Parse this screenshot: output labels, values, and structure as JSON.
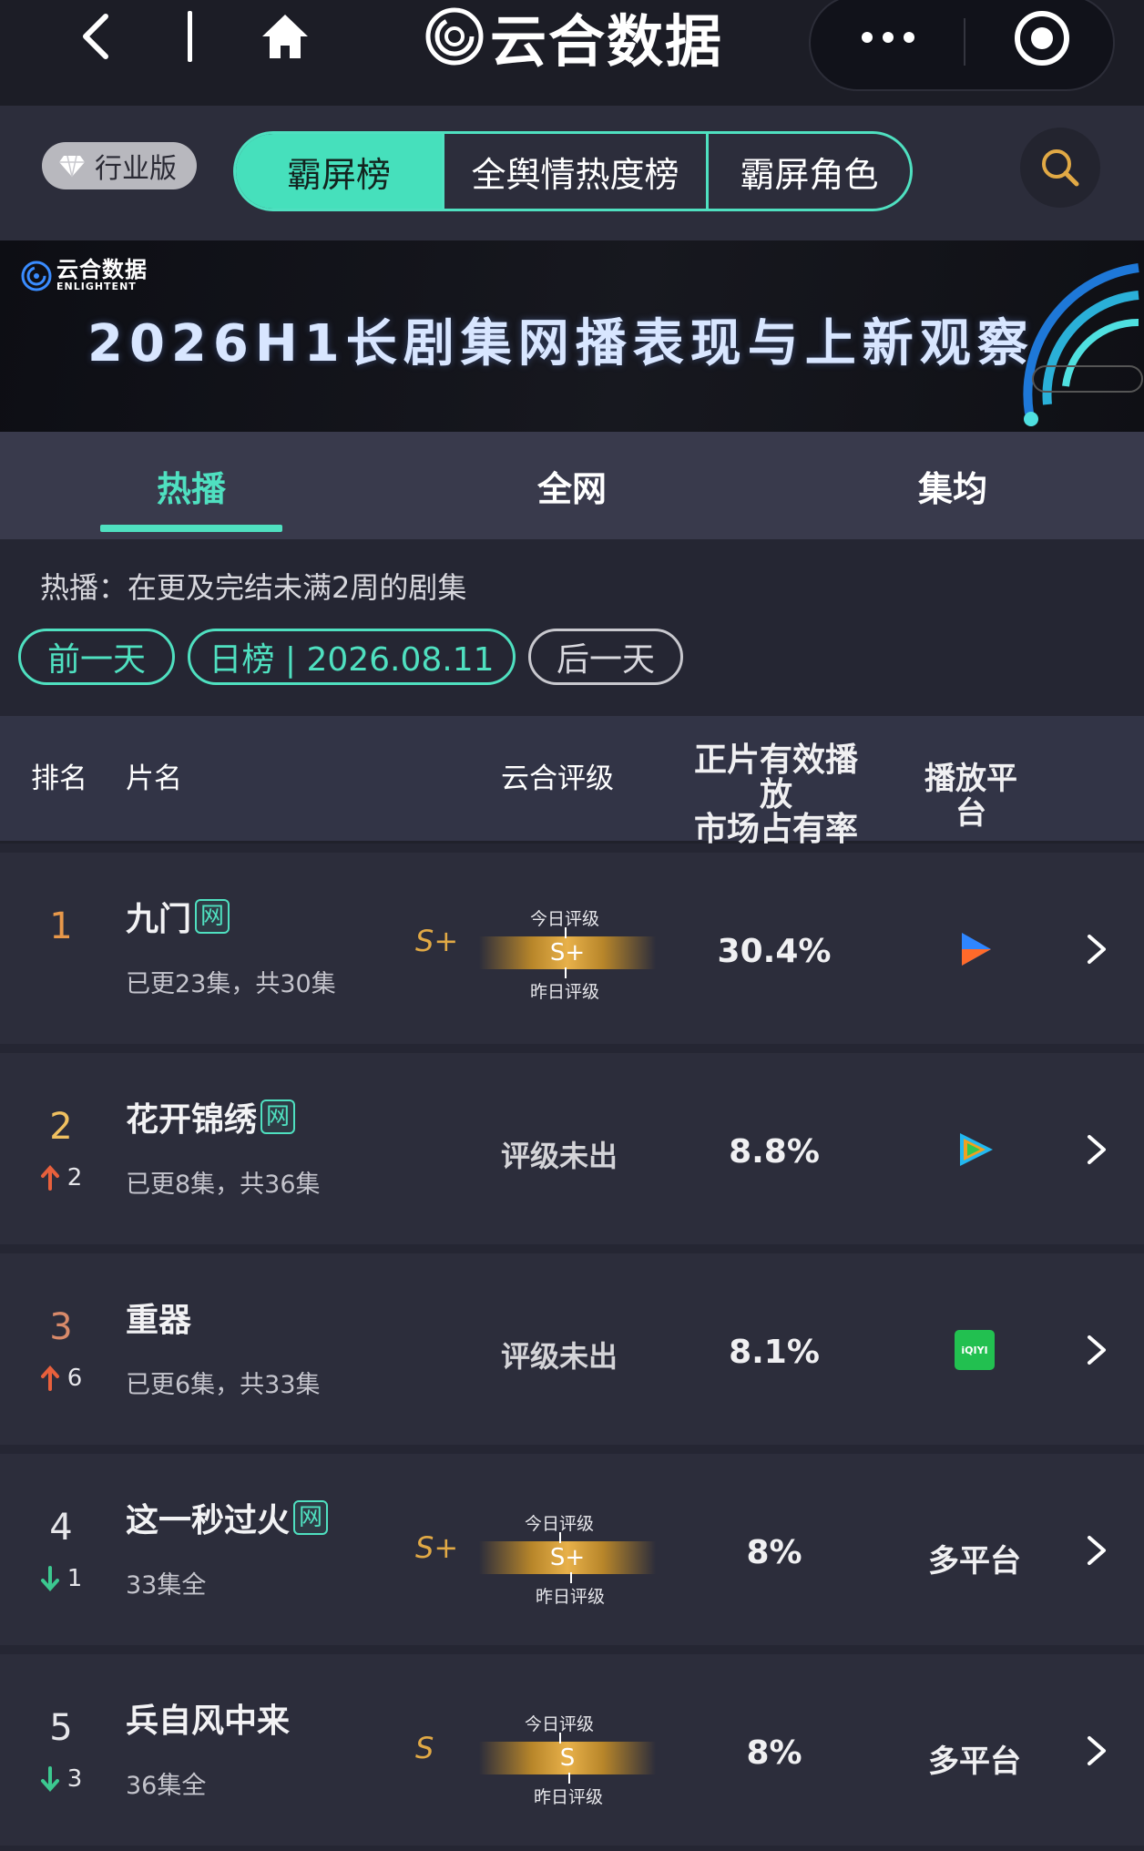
{
  "app": {
    "title": "云合数据"
  },
  "header": {
    "industry_label": "行业版",
    "segments": [
      "霸屏榜",
      "全舆情热度榜",
      "霸屏角色"
    ]
  },
  "banner": {
    "logo_zh": "云合数据",
    "logo_en": "ENLIGHTENT",
    "title": "2026H1长剧集网播表现与上新观察"
  },
  "tabs": [
    "热播",
    "全网",
    "集均"
  ],
  "info": {
    "description": "热播：在更及完结未满2周的剧集",
    "prev": "前一天",
    "date": "日榜 | 2026.08.11",
    "next": "后一天"
  },
  "table": {
    "headers": {
      "rank": "排名",
      "name": "片名",
      "rating": "云合评级",
      "share_l1": "正片有效播放",
      "share_l2": "市场占有率",
      "platform": "播放平台"
    },
    "today_label": "今日评级",
    "yesterday_label": "昨日评级",
    "rows": [
      {
        "rank": "1",
        "title": "九门",
        "tag": "网",
        "sub": "已更23集，共30集",
        "grade_left": "S+",
        "grade_bar": "S+",
        "share": "30.4%",
        "platform_icon": "youku-icon"
      },
      {
        "rank": "2",
        "move": "2",
        "move_dir": "up",
        "title": "花开锦绣",
        "tag": "网",
        "sub": "已更8集，共36集",
        "rating_text": "评级未出",
        "share": "8.8%",
        "platform_icon": "tencent-video-icon"
      },
      {
        "rank": "3",
        "move": "6",
        "move_dir": "up",
        "title": "重器",
        "sub": "已更6集，共33集",
        "rating_text": "评级未出",
        "share": "8.1%",
        "platform_icon": "iqiyi-icon",
        "platform_icon_text": "iQIYI"
      },
      {
        "rank": "4",
        "move": "1",
        "move_dir": "down",
        "title": "这一秒过火",
        "tag": "网",
        "sub": "33集全",
        "grade_left": "S+",
        "grade_bar": "S+",
        "share": "8%",
        "platform_text": "多平台"
      },
      {
        "rank": "5",
        "move": "3",
        "move_dir": "down",
        "title": "兵自风中来",
        "sub": "36集全",
        "grade_left": "S",
        "grade_bar": "S",
        "share": "8%",
        "platform_text": "多平台"
      }
    ]
  },
  "colors": {
    "accent": "#4fe0c0",
    "gold": "#e1a945",
    "rank1": "#e8984a",
    "rank2": "#f0c060",
    "rank3": "#d98a6a",
    "up": "#e8603c",
    "down": "#3cc890"
  }
}
